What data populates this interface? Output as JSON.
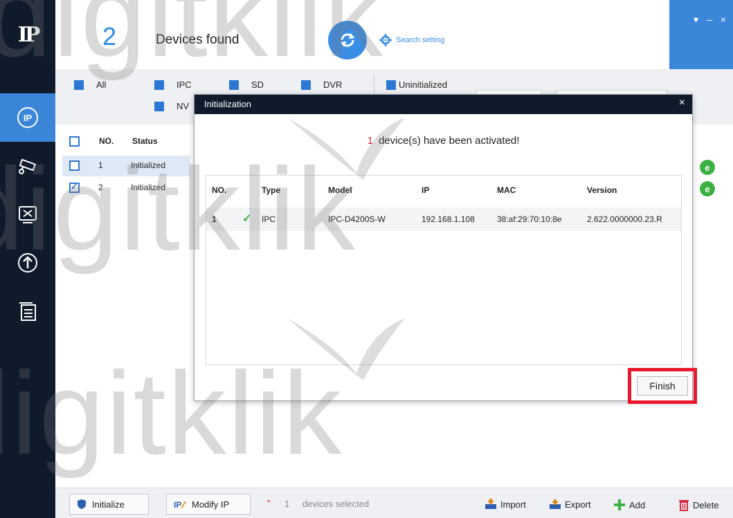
{
  "header": {
    "device_count": "2",
    "devices_found_label": "Devices found",
    "search_setting_label": "Search setting",
    "window_controls": [
      "▾",
      "–",
      "×"
    ]
  },
  "filters": {
    "all": "All",
    "ipc": "IPC",
    "sd": "SD",
    "dvr": "DVR",
    "uninitialized": "Uninitialized",
    "nvr": "NV"
  },
  "table": {
    "headers": {
      "no": "NO.",
      "status": "Status"
    },
    "rows": [
      {
        "no": "1",
        "status": "Initialized",
        "checked": false
      },
      {
        "no": "2",
        "status": "Initialized",
        "checked": true
      }
    ]
  },
  "modal": {
    "title": "Initialization",
    "close": "×",
    "count": "1",
    "message": "device(s) have been activated!",
    "headers": {
      "no": "NO.",
      "type": "Type",
      "model": "Model",
      "ip": "IP",
      "mac": "MAC",
      "version": "Version"
    },
    "row": {
      "no": "1",
      "check": "✓",
      "type": "IPC",
      "model": "IPC-D4200S-W",
      "ip": "192.168.1.108",
      "mac": "38:af:29:70:10:8e",
      "version": "2.622.0000000.23.R"
    },
    "finish_label": "Finish",
    "highlight_color": "#e8192c"
  },
  "bottom": {
    "initialize_label": "Initialize",
    "modify_ip_label": "Modify IP",
    "selected_star": "*",
    "selected_count": "1",
    "selected_label": "devices selected",
    "import_label": "Import",
    "export_label": "Export",
    "add_label": "Add",
    "delete_label": "Delete"
  },
  "watermark": "digitklik",
  "colors": {
    "accent": "#3b86d9",
    "sidebar": "#0f1b2b",
    "success": "#3cb043"
  }
}
